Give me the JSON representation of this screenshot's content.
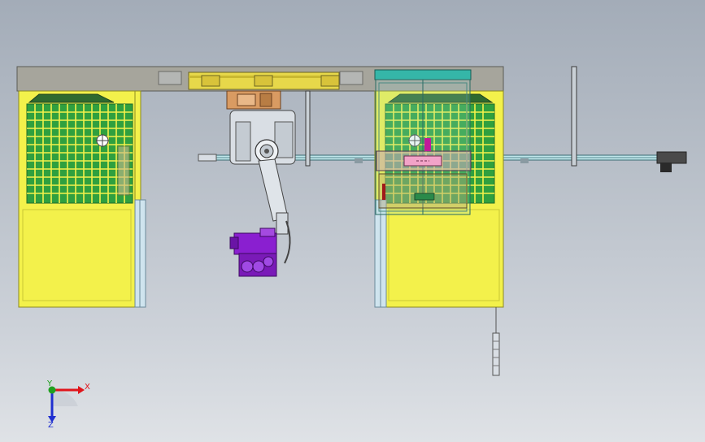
{
  "viewport": {
    "background_top": "#a3acb8",
    "background_bottom": "#dfe2e6"
  },
  "triad": {
    "x_label": "X",
    "y_label": "Y",
    "z_label": "Z",
    "x_color": "#e0141a",
    "y_color": "#1fa01f",
    "z_color": "#1f2fd0"
  },
  "colors": {
    "beam": "#a6a59c",
    "fence_yellow": "#f3f14b",
    "mesh_green": "#2a9a3c",
    "cabinet_teal": "#35b6a8",
    "robot_body": "#d9dee4",
    "gripper_purple": "#8a1fd0",
    "turntable_orange": "#d99b62",
    "rail_cyan": "#bfe6ea",
    "pink_plate": "#f2a3c8"
  },
  "icons": {
    "triad": "axis-triad-icon"
  }
}
